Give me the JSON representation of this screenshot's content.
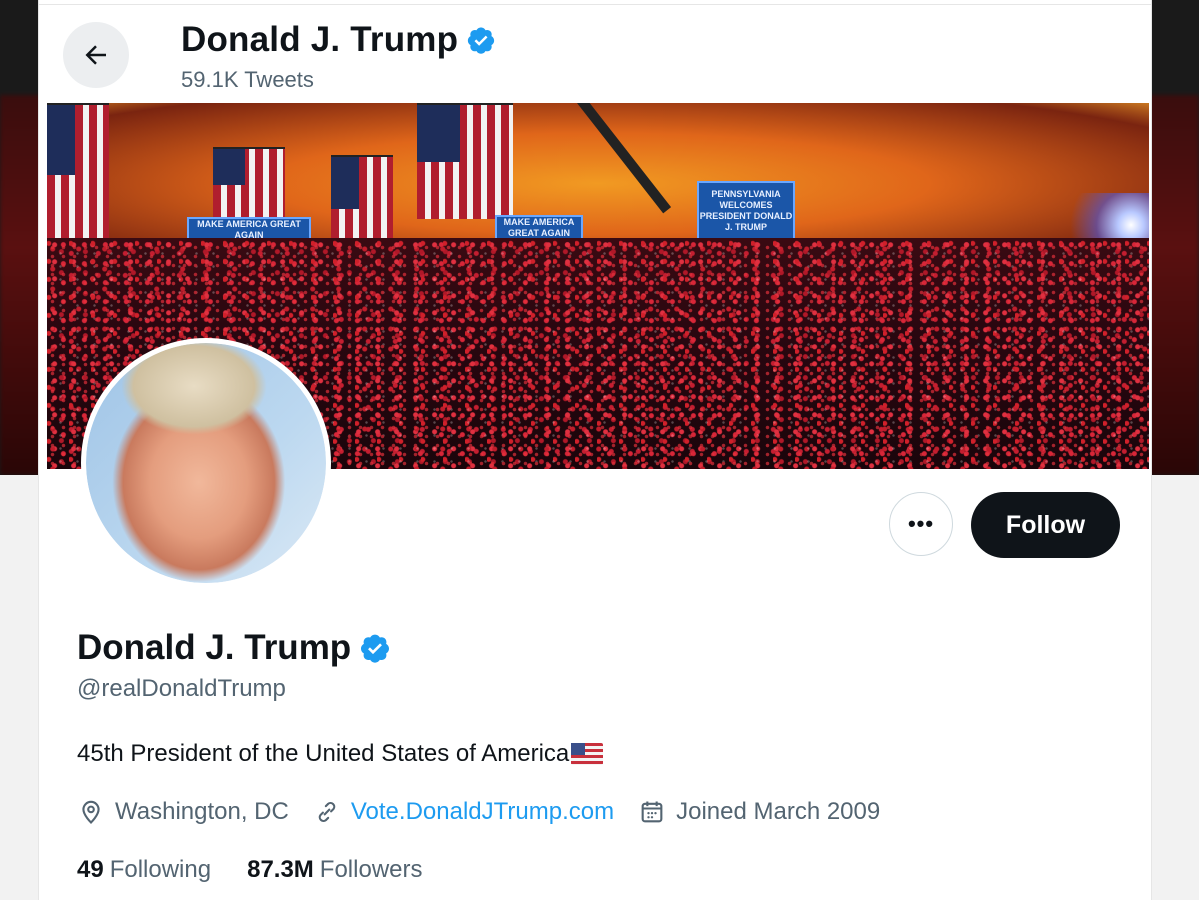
{
  "header": {
    "name": "Donald J. Trump",
    "tweet_count": "59.1K Tweets"
  },
  "banner": {
    "sign_left": "MAKE AMERICA GREAT AGAIN",
    "sign_mid": "MAKE AMERICA GREAT AGAIN",
    "sign_screen": "PENNSYLVANIA WELCOMES PRESIDENT DONALD J. TRUMP"
  },
  "actions": {
    "more_label": "•••",
    "follow_label": "Follow"
  },
  "profile": {
    "name": "Donald J. Trump",
    "handle": "@realDonaldTrump",
    "bio": "45th President of the United States of America",
    "location": "Washington, DC",
    "website": "Vote.DonaldJTrump.com",
    "joined": "Joined March 2009",
    "following_count": "49",
    "following_label": "Following",
    "followers_count": "87.3M",
    "followers_label": "Followers"
  },
  "colors": {
    "accent": "#1d9bf0",
    "text": "#0f1419",
    "muted": "#536471",
    "follow_bg": "#0f1419"
  },
  "icons": [
    "back-arrow-icon",
    "verified-badge-icon",
    "more-icon",
    "location-icon",
    "link-icon",
    "calendar-icon",
    "us-flag-icon"
  ]
}
